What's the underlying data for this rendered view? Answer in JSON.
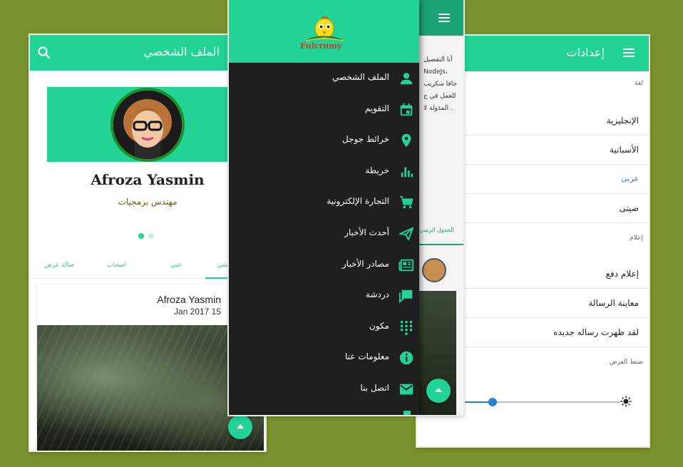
{
  "profile_screen": {
    "title": "الملف الشخصي",
    "name": "Afroza Yasmin",
    "role": "مهندس برمجيات",
    "tabs": [
      "صالة عرض",
      "اصحاب",
      "عني",
      "تمشي"
    ],
    "post": {
      "author": "Afroza Yasmin",
      "date": "Jan 2017 15"
    }
  },
  "settings_screen": {
    "title": "إعدادات",
    "sections": {
      "language": "لغة",
      "notifications": "إعلام",
      "display": "ضبط العرض"
    },
    "language_options": [
      "الإنجليزية",
      "الأسبانية",
      "عربى",
      "صينى"
    ],
    "selected_language": "عربى",
    "notification_options": [
      "إعلام دفع",
      "معاينة الرسالة",
      "لقد ظهرت رساله جديده"
    ],
    "brightness": 0.3
  },
  "drawer_screen": {
    "logo_text": "Fulcrumy",
    "menu": [
      {
        "label": "الملف الشخصي",
        "icon": "person-icon"
      },
      {
        "label": "التقويم",
        "icon": "calendar-icon"
      },
      {
        "label": "خرائط جوجل",
        "icon": "location-pin-icon"
      },
      {
        "label": "خريطة",
        "icon": "bar-chart-icon"
      },
      {
        "label": "التجارة الإلكترونية",
        "icon": "cart-icon"
      },
      {
        "label": "أحدث الأخبار",
        "icon": "send-icon"
      },
      {
        "label": "مصادر الأخبار",
        "icon": "newspaper-icon"
      },
      {
        "label": "دردشة",
        "icon": "chat-icon"
      },
      {
        "label": "مكون",
        "icon": "apps-grid-icon"
      },
      {
        "label": "معلومات عنا",
        "icon": "info-icon"
      },
      {
        "label": "اتصل بنا",
        "icon": "email-icon"
      }
    ],
    "background_page": {
      "text_lines": [
        "أنا التفصيل",
        "NodeJs،",
        "جافا سكريب",
        "للعمل في ج",
        "المدَولة لا ."
      ],
      "tab": "الجدول الزمني"
    }
  },
  "colors": {
    "accent": "#23d295",
    "background": "#79902e",
    "drawer": "#1f1f1f",
    "link": "#2a7fd4"
  }
}
